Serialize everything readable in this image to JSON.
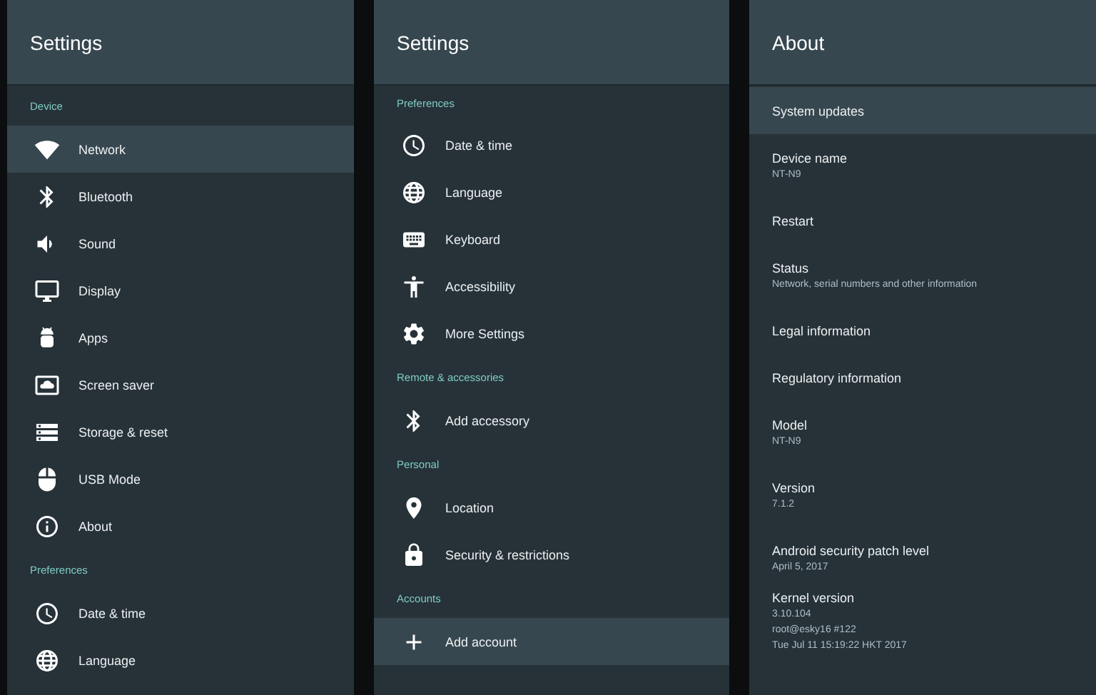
{
  "settings_panels": [
    {
      "title": "Settings",
      "sections": [
        {
          "header": "Device",
          "items": [
            {
              "label": "Network",
              "selected": true
            },
            {
              "label": "Bluetooth",
              "selected": false
            },
            {
              "label": "Sound",
              "selected": false
            },
            {
              "label": "Display",
              "selected": false
            },
            {
              "label": "Apps",
              "selected": false
            },
            {
              "label": "Screen saver",
              "selected": false
            },
            {
              "label": "Storage & reset",
              "selected": false
            },
            {
              "label": "USB Mode",
              "selected": false
            },
            {
              "label": "About",
              "selected": false
            }
          ]
        },
        {
          "header": "Preferences",
          "items": [
            {
              "label": "Date & time",
              "selected": false
            },
            {
              "label": "Language",
              "selected": false
            }
          ]
        }
      ]
    },
    {
      "title": "Settings",
      "sections": [
        {
          "header": "Preferences",
          "items": [
            {
              "label": "Date & time",
              "selected": false
            },
            {
              "label": "Language",
              "selected": false
            },
            {
              "label": "Keyboard",
              "selected": false
            },
            {
              "label": "Accessibility",
              "selected": false
            },
            {
              "label": "More Settings",
              "selected": false
            }
          ]
        },
        {
          "header": "Remote & accessories",
          "items": [
            {
              "label": "Add accessory",
              "selected": false
            }
          ]
        },
        {
          "header": "Personal",
          "items": [
            {
              "label": "Location",
              "selected": false
            },
            {
              "label": "Security & restrictions",
              "selected": false
            }
          ]
        },
        {
          "header": "Accounts",
          "items": [
            {
              "label": "Add account",
              "selected": true
            }
          ]
        }
      ]
    }
  ],
  "about_panel": {
    "title": "About",
    "items": [
      {
        "title": "System updates",
        "selected": true
      },
      {
        "title": "Device name",
        "summary": [
          "NT-N9"
        ],
        "selected": false
      },
      {
        "title": "Restart",
        "selected": false
      },
      {
        "title": "Status",
        "summary": [
          "Network, serial numbers and other information"
        ],
        "selected": false
      },
      {
        "title": "Legal information",
        "selected": false
      },
      {
        "title": "Regulatory information",
        "selected": false
      },
      {
        "title": "Model",
        "summary": [
          "NT-N9"
        ],
        "selected": false
      },
      {
        "title": "Version",
        "summary": [
          "7.1.2"
        ],
        "selected": false
      },
      {
        "title": "Android security patch level",
        "summary": [
          "April 5, 2017"
        ],
        "selected": false
      },
      {
        "title": "Kernel version",
        "summary": [
          "3.10.104",
          "root@esky16 #122",
          "Tue Jul 11 15:19:22 HKT 2017"
        ],
        "selected": false
      }
    ]
  }
}
